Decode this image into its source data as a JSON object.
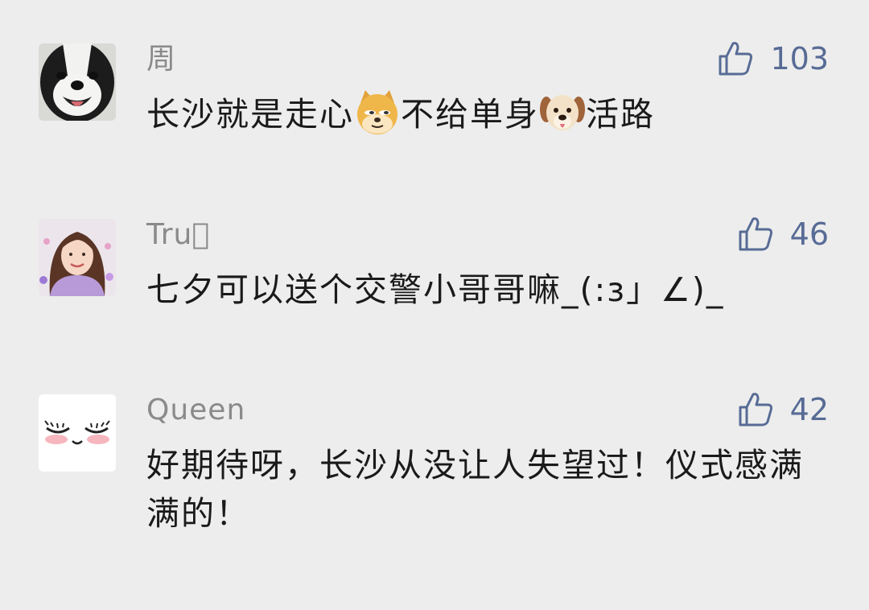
{
  "comments": [
    {
      "username": "周",
      "likes": "103",
      "text_parts": [
        "长沙就是走心",
        "不给单身",
        "活路"
      ],
      "emojis": [
        "shiba-doge-emoji",
        "dog-face-emoji"
      ]
    },
    {
      "username": "Tru⃞",
      "likes": "46",
      "text": "七夕可以送个交警小哥哥嘛_(:з」∠)_"
    },
    {
      "username": "Queen",
      "likes": "42",
      "text": "好期待呀，长沙从没让人失望过！仪式感满满的！"
    }
  ],
  "icons": {
    "like": "thumbs-up-icon"
  },
  "colors": {
    "background": "#ededed",
    "username": "#8a8a8a",
    "like": "#576b95",
    "text": "#1a1a1a"
  }
}
